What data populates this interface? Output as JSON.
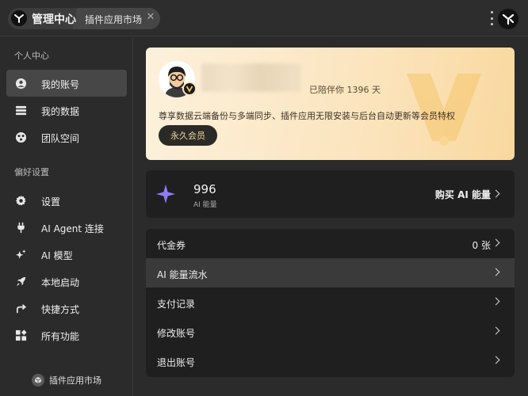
{
  "topbar": {
    "active_tab": "管理中心",
    "second_tab": "插件应用市场",
    "close_glyph": "✕",
    "icons": [
      "app-logo-icon",
      "close-icon",
      "more-vertical-icon"
    ]
  },
  "sidebar": {
    "section_personal": "个人中心",
    "section_prefs": "偏好设置",
    "items": [
      {
        "label": "我的账号",
        "icon": "user-circle-icon"
      },
      {
        "label": "我的数据",
        "icon": "database-icon"
      },
      {
        "label": "团队空间",
        "icon": "team-icon"
      },
      {
        "label": "设置",
        "icon": "gear-icon"
      },
      {
        "label": "AI Agent 连接",
        "icon": "plug-icon"
      },
      {
        "label": "AI 模型",
        "icon": "sparkles-icon"
      },
      {
        "label": "本地启动",
        "icon": "rocket-icon"
      },
      {
        "label": "快捷方式",
        "icon": "share-arrow-icon"
      },
      {
        "label": "所有功能",
        "icon": "grid-icon"
      }
    ],
    "footer": "插件应用市场"
  },
  "member": {
    "days": "已陪伴你 1396 天",
    "privileges": "尊享数据云端备份与多端同步、插件应用无限安装与后台自动更新等会员特权",
    "badge_button": "永久会员"
  },
  "energy": {
    "value": "996",
    "label": "AI 能量",
    "buy": "购买 AI 能量"
  },
  "menu": {
    "rows": [
      {
        "label": "代金券",
        "count": "0 张"
      },
      {
        "label": "AI 能量流水",
        "count": ""
      },
      {
        "label": "支付记录",
        "count": ""
      },
      {
        "label": "修改账号",
        "count": ""
      },
      {
        "label": "退出账号",
        "count": ""
      }
    ]
  },
  "colors": {
    "bg": "#2b2b2b",
    "card": "#1f1f1f",
    "active": "#474747",
    "gold": "#fbe4bd",
    "accent_spark": "#8f7cf6"
  }
}
